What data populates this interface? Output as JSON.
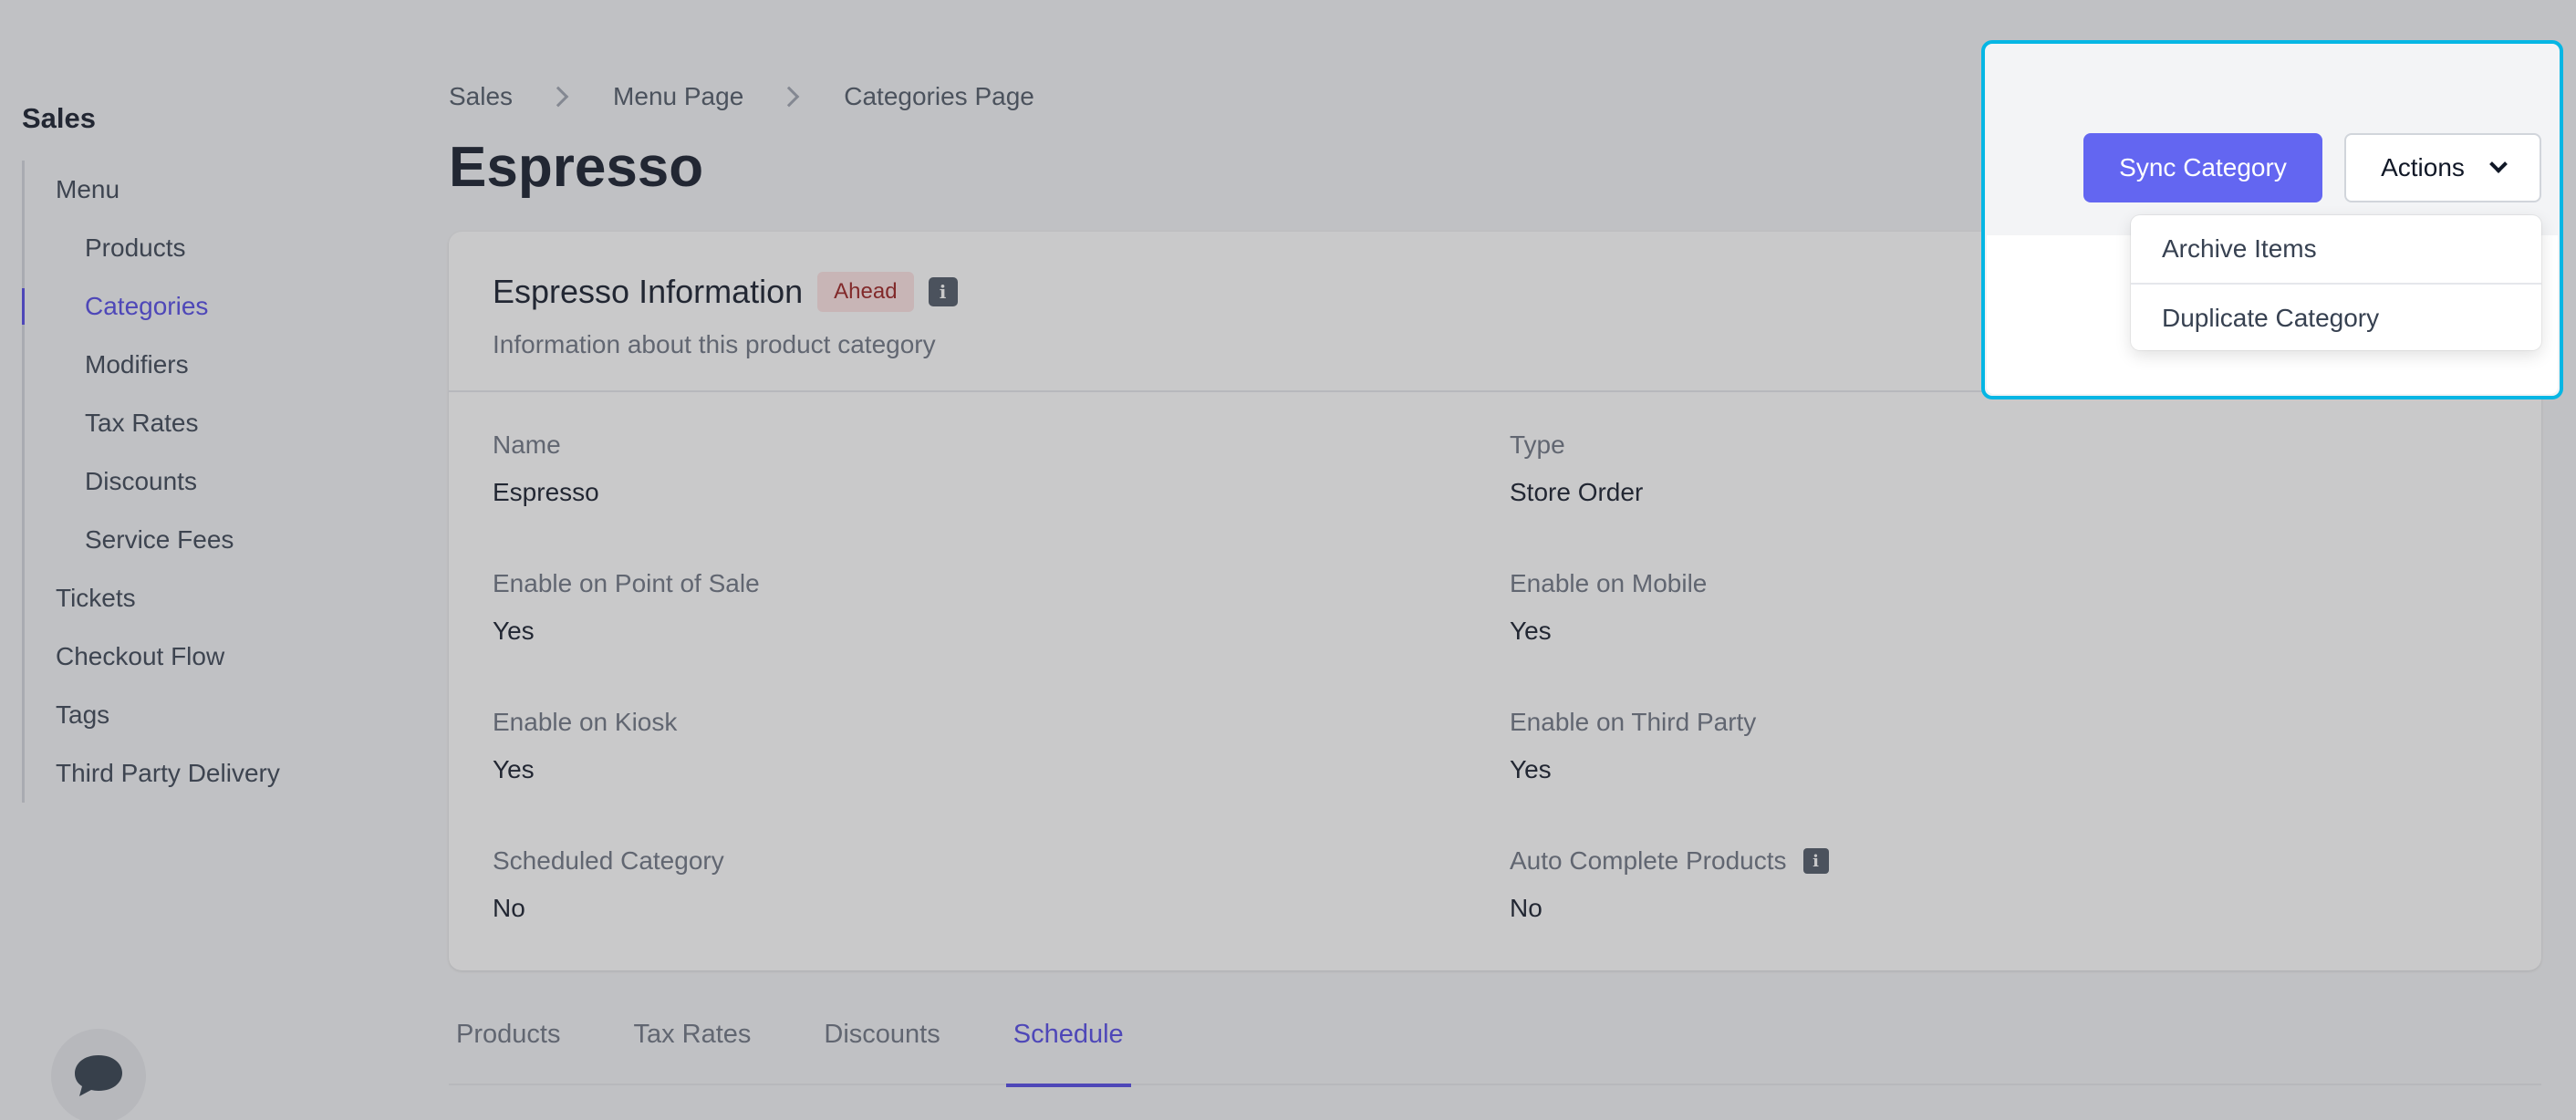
{
  "sidebar": {
    "title": "Sales",
    "items": [
      {
        "label": "Menu",
        "sub": false,
        "active": false
      },
      {
        "label": "Products",
        "sub": true,
        "active": false
      },
      {
        "label": "Categories",
        "sub": true,
        "active": true
      },
      {
        "label": "Modifiers",
        "sub": true,
        "active": false
      },
      {
        "label": "Tax Rates",
        "sub": true,
        "active": false
      },
      {
        "label": "Discounts",
        "sub": true,
        "active": false
      },
      {
        "label": "Service Fees",
        "sub": true,
        "active": false
      },
      {
        "label": "Tickets",
        "sub": false,
        "active": false
      },
      {
        "label": "Checkout Flow",
        "sub": false,
        "active": false
      },
      {
        "label": "Tags",
        "sub": false,
        "active": false
      },
      {
        "label": "Third Party Delivery",
        "sub": false,
        "active": false
      }
    ]
  },
  "breadcrumb": [
    "Sales",
    "Menu Page",
    "Categories Page"
  ],
  "page_title": "Espresso",
  "header_actions": {
    "sync_label": "Sync Category",
    "actions_label": "Actions",
    "menu_items": [
      "Archive Items",
      "Duplicate Category"
    ]
  },
  "card": {
    "title": "Espresso Information",
    "badge": "Ahead",
    "subtitle": "Information about this product category",
    "fields": [
      {
        "label": "Name",
        "value": "Espresso"
      },
      {
        "label": "Type",
        "value": "Store Order"
      },
      {
        "label": "Enable on Point of Sale",
        "value": "Yes"
      },
      {
        "label": "Enable on Mobile",
        "value": "Yes"
      },
      {
        "label": "Enable on Kiosk",
        "value": "Yes"
      },
      {
        "label": "Enable on Third Party",
        "value": "Yes"
      },
      {
        "label": "Scheduled Category",
        "value": "No"
      },
      {
        "label": "Auto Complete Products",
        "value": "No",
        "info": true
      }
    ]
  },
  "tabs": [
    {
      "label": "Products",
      "active": false
    },
    {
      "label": "Tax Rates",
      "active": false
    },
    {
      "label": "Discounts",
      "active": false
    },
    {
      "label": "Schedule",
      "active": true
    }
  ],
  "icons": {
    "info": "info-icon",
    "chat": "chat-bubble-icon",
    "chevron": "chevron-down-icon"
  },
  "colors": {
    "accent": "#4f46e5",
    "button": "#6366f1",
    "badge_bg": "#fee2e2",
    "badge_text": "#991b1b",
    "highlight": "#06b6e4"
  }
}
